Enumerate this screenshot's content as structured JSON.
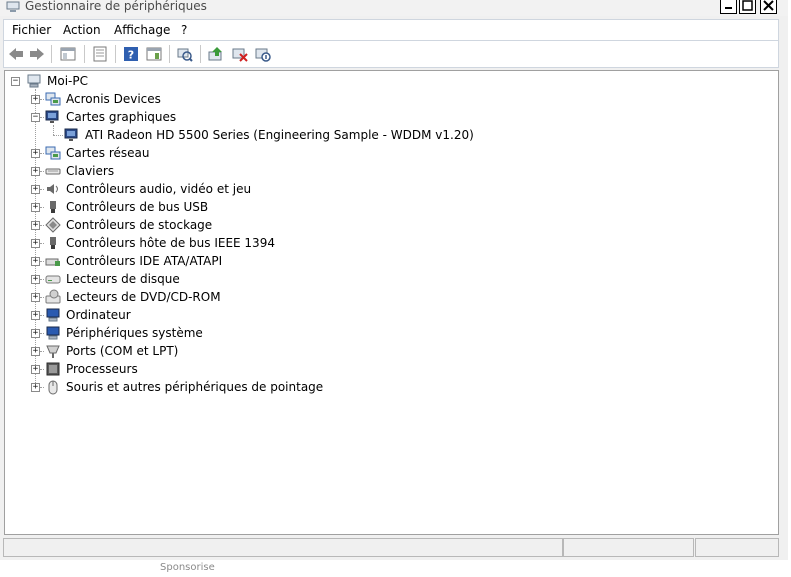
{
  "window": {
    "title": "Gestionnaire de périphériques"
  },
  "menu": [
    "Fichier",
    "Action",
    "Affichage",
    "?"
  ],
  "toolbar_icons": [
    "back-arrow-icon",
    "forward-arrow-icon",
    "console-tree-icon",
    "properties-icon",
    "help-icon",
    "action-pane-icon",
    "scan-hardware-icon",
    "update-driver-icon",
    "uninstall-icon",
    "disable-device-icon"
  ],
  "tree": {
    "root": "Moi-PC",
    "categories": [
      {
        "label": "Acronis Devices",
        "icon": "network-device-icon",
        "expanded": false
      },
      {
        "label": "Cartes graphiques",
        "icon": "display-adapter-icon",
        "expanded": true,
        "children": [
          "ATI Radeon HD 5500 Series (Engineering Sample - WDDM v1.20)"
        ]
      },
      {
        "label": "Cartes réseau",
        "icon": "network-adapter-icon",
        "expanded": false
      },
      {
        "label": "Claviers",
        "icon": "keyboard-icon",
        "expanded": false
      },
      {
        "label": "Contrôleurs audio, vidéo et jeu",
        "icon": "speaker-icon",
        "expanded": false
      },
      {
        "label": "Contrôleurs de bus USB",
        "icon": "usb-icon",
        "expanded": false
      },
      {
        "label": "Contrôleurs de stockage",
        "icon": "storage-controller-icon",
        "expanded": false
      },
      {
        "label": "Contrôleurs hôte de bus IEEE 1394",
        "icon": "firewire-icon",
        "expanded": false
      },
      {
        "label": "Contrôleurs IDE ATA/ATAPI",
        "icon": "ide-controller-icon",
        "expanded": false
      },
      {
        "label": "Lecteurs de disque",
        "icon": "disk-drive-icon",
        "expanded": false
      },
      {
        "label": "Lecteurs de DVD/CD-ROM",
        "icon": "dvd-drive-icon",
        "expanded": false
      },
      {
        "label": "Ordinateur",
        "icon": "computer-icon",
        "expanded": false
      },
      {
        "label": "Périphériques système",
        "icon": "system-device-icon",
        "expanded": false
      },
      {
        "label": "Ports (COM et LPT)",
        "icon": "port-icon",
        "expanded": false
      },
      {
        "label": "Processeurs",
        "icon": "processor-icon",
        "expanded": false
      },
      {
        "label": "Souris et autres périphériques de pointage",
        "icon": "mouse-icon",
        "expanded": false
      }
    ]
  },
  "footer_text": "Sponsorise"
}
